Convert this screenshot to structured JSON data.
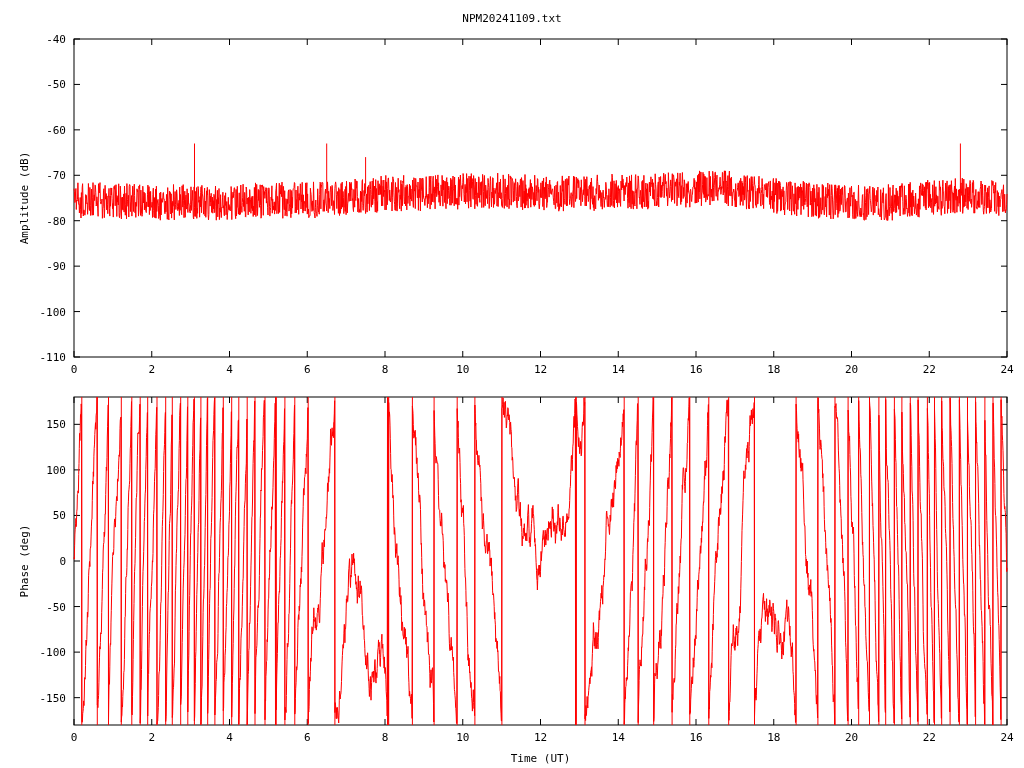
{
  "title": "NPM20241109.txt",
  "amplitude": {
    "ylabel": "Amplitude (dB)",
    "yticks": [
      "-40",
      "-50",
      "-60",
      "-70",
      "-80",
      "-90",
      "-100",
      "-110"
    ],
    "xticks": [
      "0",
      "2",
      "4",
      "6",
      "8",
      "10",
      "12",
      "14",
      "16",
      "18",
      "20",
      "22",
      "24"
    ]
  },
  "phase": {
    "ylabel": "Phase (deg)",
    "xlabel": "Time (UT)",
    "yticks": [
      "150",
      "100",
      "50",
      "0",
      "-50",
      "-100",
      "-150"
    ],
    "xticks": [
      "0",
      "2",
      "4",
      "6",
      "8",
      "10",
      "12",
      "14",
      "16",
      "18",
      "20",
      "22",
      "24"
    ]
  }
}
